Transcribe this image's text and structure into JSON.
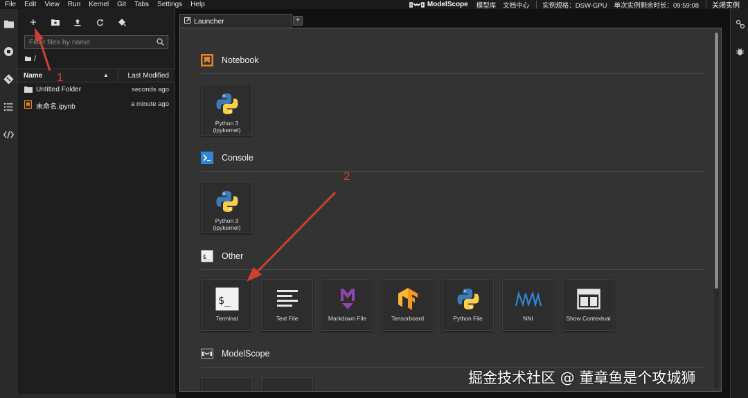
{
  "menubar": {
    "items": [
      "File",
      "Edit",
      "View",
      "Run",
      "Kernel",
      "Git",
      "Tabs",
      "Settings",
      "Help"
    ],
    "brand": "ModelScope",
    "links": [
      "模型库",
      "文档中心"
    ],
    "instance_spec": "实例规格：DSW-GPU",
    "remaining_time": "单次实例剩余时长：09:59:08",
    "close_instance": "关闭实例"
  },
  "filebrowser": {
    "search_placeholder": "Filter files by name",
    "breadcrumb": "/",
    "columns": {
      "name": "Name",
      "modified": "Last Modified"
    },
    "files": [
      {
        "name": "Untitled Folder",
        "modified": "seconds ago",
        "type": "folder"
      },
      {
        "name": "未命名.ipynb",
        "modified": "a minute ago",
        "type": "notebook"
      }
    ]
  },
  "tabs": {
    "active": "Launcher",
    "add": "+"
  },
  "launcher": {
    "sections": [
      {
        "title": "Notebook",
        "items": [
          {
            "label": "Python 3 (ipykernel)",
            "icon": "python-icon"
          }
        ]
      },
      {
        "title": "Console",
        "items": [
          {
            "label": "Python 3 (ipykernel)",
            "icon": "python-icon"
          }
        ]
      },
      {
        "title": "Other",
        "items": [
          {
            "label": "Terminal",
            "icon": "terminal-icon"
          },
          {
            "label": "Text File",
            "icon": "text-file-icon"
          },
          {
            "label": "Markdown File",
            "icon": "markdown-icon"
          },
          {
            "label": "Tensorboard",
            "icon": "tensorboard-icon"
          },
          {
            "label": "Python File",
            "icon": "python-icon"
          },
          {
            "label": "NNI",
            "icon": "nni-icon"
          },
          {
            "label": "Show Contextual",
            "icon": "contextual-help-icon"
          }
        ]
      },
      {
        "title": "ModelScope",
        "items": []
      }
    ]
  },
  "annotations": {
    "step1": "1",
    "step2": "2",
    "arrow_color": "#d0402e"
  },
  "watermark": "掘金技术社区 @ 董章鱼是个攻城狮",
  "colors": {
    "python_blue": "#3d7ab8",
    "python_yellow": "#f7cf4a",
    "notebook_orange": "#e8832a",
    "console_blue": "#2f86d6",
    "markdown_purple": "#8e44ad",
    "tensorboard_orange": "#f29a1f",
    "nni_blue": "#2f86d6"
  }
}
